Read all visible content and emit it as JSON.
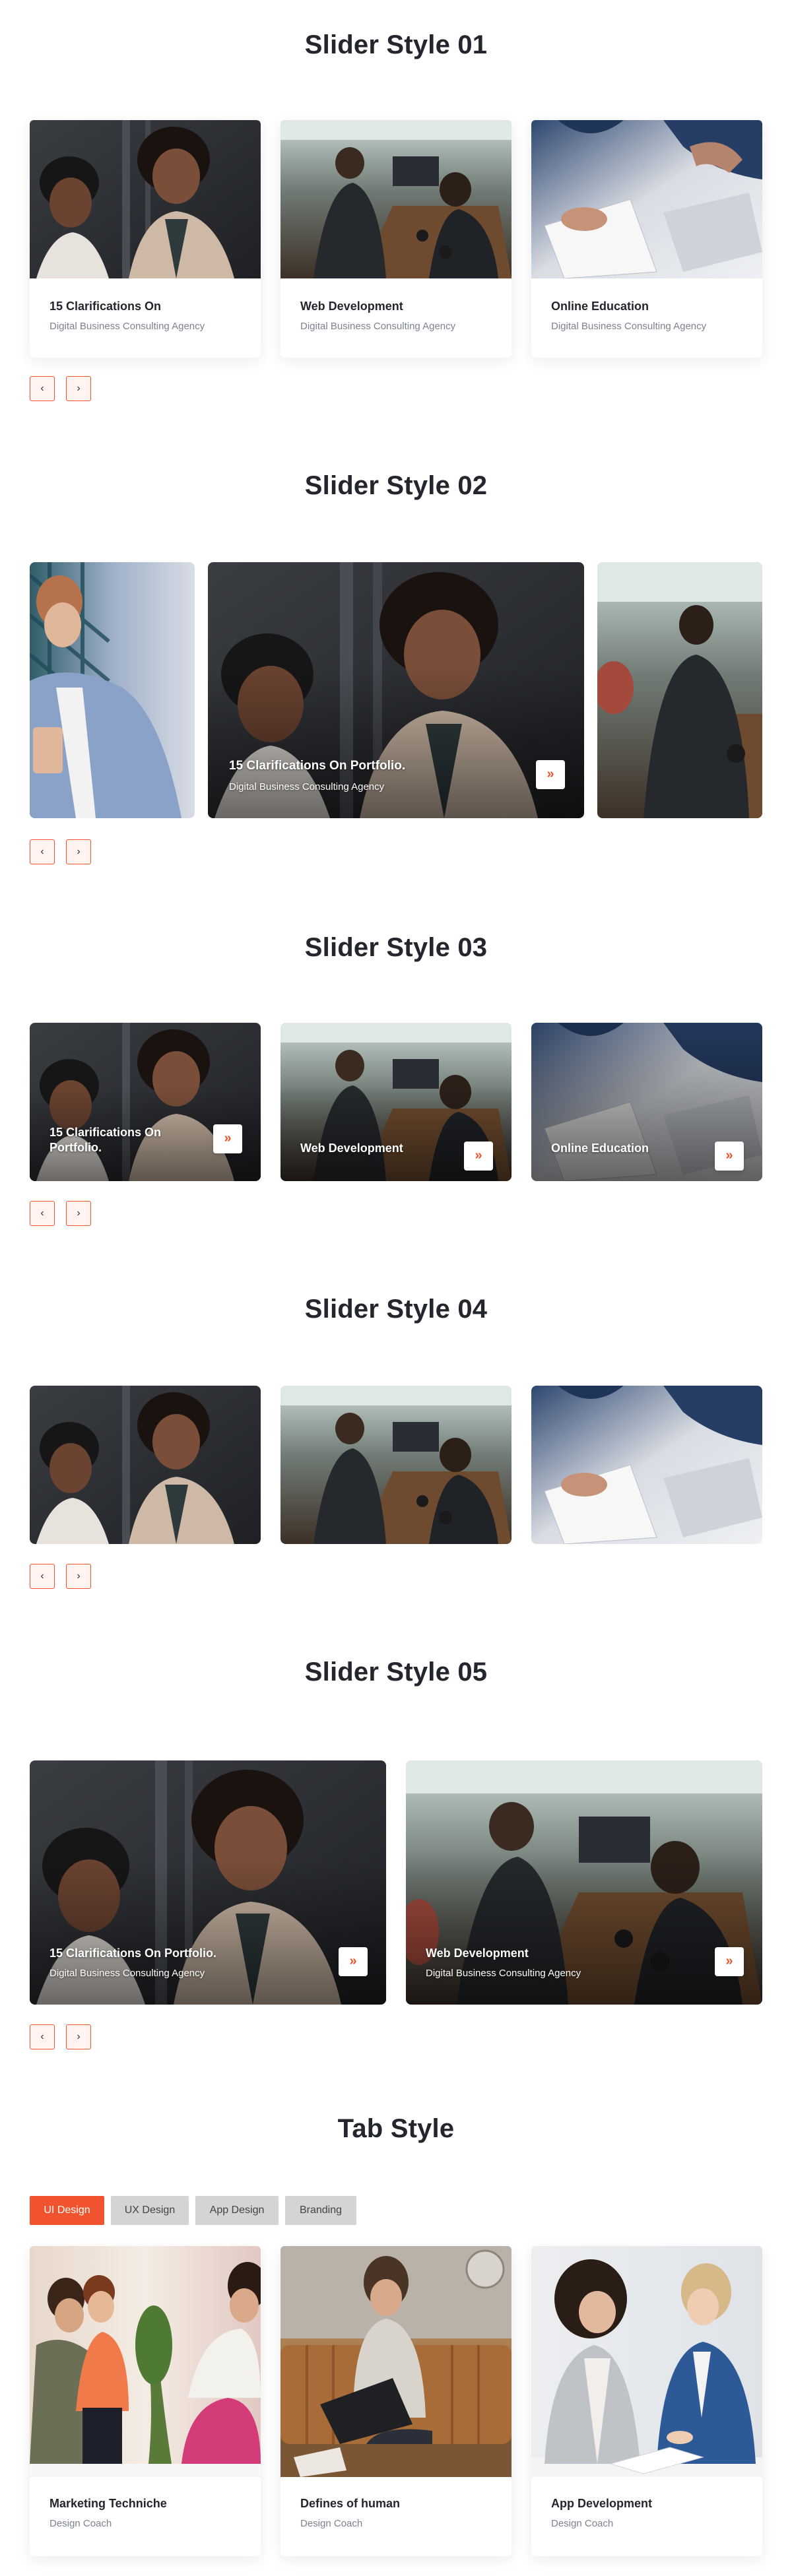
{
  "colors": {
    "accent": "#f0532d",
    "title": "#23262d",
    "muted": "#7c8290",
    "tab_inactive": "#d4d4d4"
  },
  "nav": {
    "prev": "‹",
    "next": "›",
    "go": "»"
  },
  "slider1": {
    "title": "Slider Style 01",
    "cards": [
      {
        "title": "15 Clarifications On",
        "subtitle": "Digital Business Consulting Agency"
      },
      {
        "title": "Web Development",
        "subtitle": "Digital Business Consulting Agency"
      },
      {
        "title": "Online Education",
        "subtitle": "Digital Business Consulting Agency"
      }
    ]
  },
  "slider2": {
    "title": "Slider Style 02",
    "featured": {
      "title": "15 Clarifications On Portfolio.",
      "subtitle": "Digital Business Consulting Agency"
    }
  },
  "slider3": {
    "title": "Slider Style 03",
    "cards": [
      {
        "title_line1": "15 Clarifications On",
        "title_line2": "Portfolio."
      },
      {
        "title": "Web Development"
      },
      {
        "title": "Online Education"
      }
    ]
  },
  "slider4": {
    "title": "Slider Style 04"
  },
  "slider5": {
    "title": "Slider Style 05",
    "cards": [
      {
        "title": "15 Clarifications On Portfolio.",
        "subtitle": "Digital Business Consulting Agency"
      },
      {
        "title": "Web Development",
        "subtitle": "Digital Business Consulting Agency"
      }
    ]
  },
  "tabs": {
    "title": "Tab Style",
    "items": [
      "UI Design",
      "UX Design",
      "App Design",
      "Branding"
    ],
    "cards": [
      {
        "title": "Marketing Techniche",
        "subtitle": "Design Coach"
      },
      {
        "title": "Defines of human",
        "subtitle": "Design Coach"
      },
      {
        "title": "App Development",
        "subtitle": "Design Coach"
      }
    ]
  }
}
